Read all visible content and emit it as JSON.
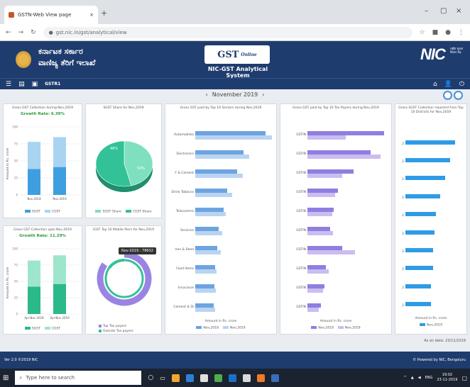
{
  "browser": {
    "tab_title": "GSTN-Web View page",
    "url": "gst.nic.in/gst/analytical/view",
    "new_tab": "+",
    "close_tab": "×",
    "win_min": "–",
    "win_max": "▢",
    "win_close": "×"
  },
  "header": {
    "kannada_line1": "ಕರ್ನಾಟಕ ಸರ್ಕಾರ",
    "kannada_line2": "ವಾಣಿಜ್ಯ ತೆರಿಗೆ ಇಲಾಖೆ",
    "gst_logo": "GST",
    "gst_logo_sub": "Online",
    "system_title": "NIC-GST Analytical System",
    "nic_logo": "NIC",
    "nic_sub": "राष्ट्रीय सूचना विज्ञान केंद्र"
  },
  "menu": {
    "label": "GSTR1"
  },
  "date_nav": {
    "prev": "‹",
    "label": "November 2019",
    "next": "›"
  },
  "panel1": {
    "title": "Gross GST Collection during Nov,2019",
    "growth": "Growth Rate: 6.39%",
    "ylabel": "Amount in Rs. crore",
    "legend": [
      "SGST",
      "CGST"
    ],
    "colors": {
      "a": "#3f9ee0",
      "b": "#a8d4f2"
    },
    "chart_data": {
      "type": "bar",
      "categories": [
        "Nov,2018",
        "Nov,2019"
      ],
      "ylim": [
        0,
        100
      ],
      "series": [
        {
          "name": "SGST",
          "values": [
            38,
            41
          ]
        },
        {
          "name": "CGST",
          "values": [
            40,
            44
          ]
        }
      ]
    }
  },
  "panel2": {
    "title": "SGST Share for Nov,2019",
    "slice_a": "46%",
    "slice_b": "54%",
    "legend": [
      "SGST Share",
      "CGST Share"
    ],
    "colors": {
      "a": "#7fe0c0",
      "b": "#33c297"
    },
    "chart_data": {
      "type": "pie",
      "labels": [
        "SGST Share",
        "CGST Share"
      ],
      "values": [
        46,
        54
      ]
    }
  },
  "panel3": {
    "title": "Gross GST Collection upto Nov,2019",
    "growth": "Growth Rate: 11.29%",
    "ylabel": "Amount in Rs. crore",
    "legend": [
      "SGST",
      "CGST"
    ],
    "colors": {
      "a": "#2bb88a",
      "b": "#9de6cc"
    },
    "chart_data": {
      "type": "bar",
      "categories": [
        "Apr-Nov 2018",
        "Apr-Nov 2019"
      ],
      "ylim": [
        0,
        100
      ],
      "series": [
        {
          "name": "SGST",
          "values": [
            42,
            46
          ]
        },
        {
          "name": "CGST",
          "values": [
            40,
            44
          ]
        }
      ]
    }
  },
  "panel4": {
    "title": "IGST Top 10 Mobile filers for Nov,2019",
    "tooltip": "Nov-2019 : 78632",
    "legend": [
      "Top Tax payers",
      "Outside Tax payers"
    ],
    "colors": {
      "a": "#9a84e3",
      "b": "#33c297"
    },
    "chart_data": {
      "type": "pie",
      "labels": [
        "Top Tax payers",
        "Outside Tax payers"
      ],
      "values": [
        85,
        15
      ]
    }
  },
  "panel5": {
    "title": "Gross GST paid by Top 10 Sectors during Nov,2019",
    "xlabel": "Amount in Rs. crore",
    "legend": [
      "Nov,2018",
      "Nov,2019"
    ],
    "colors": {
      "a": "#6da4e0",
      "b": "#b9d4f3"
    },
    "chart_data": {
      "type": "bar",
      "orientation": "horizontal",
      "categories": [
        "Automobiles",
        "Electronics",
        "F & Cement",
        "Drink Tobacco",
        "Telecomms",
        "Services",
        "Iron & Steel",
        "Food Items",
        "Insurance",
        "Cement & St"
      ],
      "series": [
        {
          "name": "Nov,2018",
          "values": [
            92,
            63,
            55,
            42,
            37,
            31,
            29,
            26,
            25,
            24
          ]
        },
        {
          "name": "Nov,2019",
          "values": [
            100,
            70,
            62,
            48,
            40,
            35,
            33,
            28,
            27,
            26
          ]
        }
      ]
    }
  },
  "panel6": {
    "title": "Gross GST paid by Top 10 Tax Payers during Nov,2019",
    "xlabel": "Amount in Rs. crore",
    "legend": [
      "Nov,2018",
      "Nov,2019"
    ],
    "row_label": "GSTIN",
    "colors": {
      "a": "#8e7fe0",
      "b": "#cbbcf2"
    },
    "chart_data": {
      "type": "bar",
      "orientation": "horizontal",
      "categories": [
        "GSTIN",
        "GSTIN",
        "GSTIN",
        "GSTIN",
        "GSTIN",
        "GSTIN",
        "GSTIN",
        "GSTIN",
        "GSTIN",
        "GSTIN"
      ],
      "series": [
        {
          "name": "Nov,2018",
          "values": [
            100,
            82,
            60,
            40,
            34,
            30,
            45,
            24,
            22,
            18
          ]
        },
        {
          "name": "Nov,2019",
          "values": [
            50,
            95,
            45,
            36,
            32,
            33,
            62,
            28,
            20,
            15
          ]
        }
      ]
    }
  },
  "panel7": {
    "title": "Gross SGST Collection reported from Top 10 Districts for Nov,2019",
    "xlabel": "Amount in Rs. crore",
    "legend": [
      "Nov,2019"
    ],
    "row_label": "2",
    "colors": {
      "a": "#2f9be6"
    },
    "chart_data": {
      "type": "bar",
      "orientation": "horizontal",
      "categories": [
        "2",
        "2",
        "2",
        "2",
        "2",
        "2",
        "2",
        "2",
        "2",
        "2"
      ],
      "series": [
        {
          "name": "Nov,2019",
          "values": [
            100,
            90,
            80,
            70,
            62,
            58,
            56,
            55,
            52,
            52
          ]
        }
      ]
    }
  },
  "as_on": "As on date: 23/11/2019",
  "footer": {
    "left": "Ver 2.0 ©2019 NIC",
    "right": "© Powered by NIC, Bengaluru"
  },
  "taskbar": {
    "search": "Type here to search",
    "time": "19:02",
    "date": "23-11-2019",
    "lang": "ENG"
  }
}
